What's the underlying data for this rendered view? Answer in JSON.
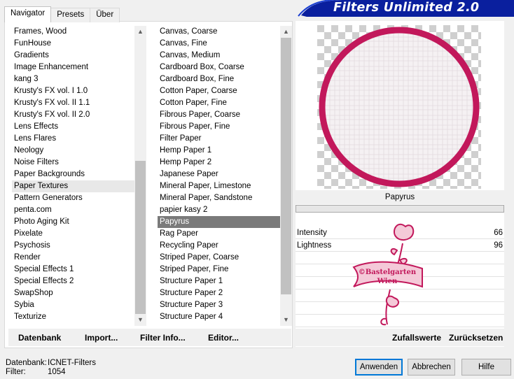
{
  "tabs": [
    "Navigator",
    "Presets",
    "Über"
  ],
  "app_title": "Filters Unlimited 2.0",
  "categories": {
    "items": [
      "Frames, Wood",
      "FunHouse",
      "Gradients",
      "Image Enhancement",
      "kang 3",
      "Krusty's FX vol. I 1.0",
      "Krusty's FX vol. II 1.1",
      "Krusty's FX vol. II 2.0",
      "Lens Effects",
      "Lens Flares",
      "Neology",
      "Noise Filters",
      "Paper Backgrounds",
      "Paper Textures",
      "Pattern Generators",
      "penta.com",
      "Photo Aging Kit",
      "Pixelate",
      "Psychosis",
      "Render",
      "Special Effects 1",
      "Special Effects 2",
      "SwapShop",
      "Sybia",
      "Texturize"
    ],
    "highlighted": "Paper Textures",
    "scroll_position": 0.63
  },
  "filters": {
    "items": [
      "Canvas, Coarse",
      "Canvas, Fine",
      "Canvas, Medium",
      "Cardboard Box, Coarse",
      "Cardboard Box, Fine",
      "Cotton Paper, Coarse",
      "Cotton Paper, Fine",
      "Fibrous Paper, Coarse",
      "Fibrous Paper, Fine",
      "Filter Paper",
      "Hemp Paper 1",
      "Hemp Paper 2",
      "Japanese Paper",
      "Mineral Paper, Limestone",
      "Mineral Paper, Sandstone",
      "papier kasy 2",
      "Papyrus",
      "Rag Paper",
      "Recycling Paper",
      "Striped Paper, Coarse",
      "Striped Paper, Fine",
      "Structure Paper 1",
      "Structure Paper 2",
      "Structure Paper 3",
      "Structure Paper 4"
    ],
    "selected": "Papyrus",
    "scroll_position": 0.0
  },
  "bottom_buttons": {
    "database": "Datenbank",
    "import": "Import...",
    "filter_info": "Filter Info...",
    "editor": "Editor..."
  },
  "preview": {
    "filter_name": "Papyrus",
    "watermark_line1": "©Bastelgarten",
    "watermark_line2": "Wien",
    "ring_color": "#c2185b"
  },
  "parameters": [
    {
      "label": "Intensity",
      "value": "66"
    },
    {
      "label": "Lightness",
      "value": "96"
    }
  ],
  "right_buttons": {
    "randomize": "Zufallswerte",
    "reset": "Zurücksetzen"
  },
  "status": {
    "database_label": "Datenbank:",
    "database_value": "ICNET-Filters",
    "filter_label": "Filter:",
    "filter_value": "1054"
  },
  "dialog_buttons": {
    "apply": "Anwenden",
    "cancel": "Abbrechen",
    "help": "Hilfe"
  },
  "colors": {
    "banner": "#0a1f9e",
    "ring": "#c2185b",
    "selection": "#7a7a7a"
  }
}
